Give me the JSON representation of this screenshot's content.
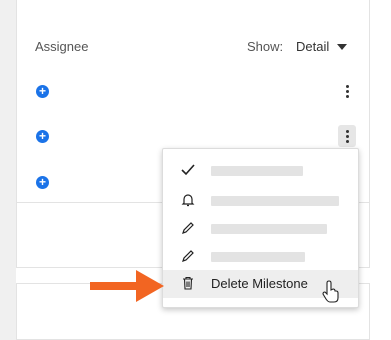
{
  "header": {
    "column_label": "Assignee",
    "show_label": "Show:",
    "show_value": "Detail"
  },
  "rows": [
    {
      "add_icon": "plus-circle-icon",
      "more_icon": "kebab-icon"
    },
    {
      "add_icon": "plus-circle-icon",
      "more_icon": "kebab-icon"
    },
    {
      "add_icon": "plus-circle-icon"
    }
  ],
  "menu": {
    "items": [
      {
        "icon": "checkmark-icon",
        "label_redacted": true
      },
      {
        "icon": "bell-icon",
        "label_redacted": true
      },
      {
        "icon": "pencil-icon",
        "label_redacted": true
      },
      {
        "icon": "pencil-icon",
        "label_redacted": true
      },
      {
        "icon": "trash-icon",
        "label": "Delete Milestone",
        "hovered": true
      }
    ]
  },
  "annotation": {
    "arrow_color": "#f26522",
    "cursor": "hand-pointer-icon"
  },
  "colors": {
    "accent": "#1b73e8",
    "arrow": "#f26522"
  }
}
